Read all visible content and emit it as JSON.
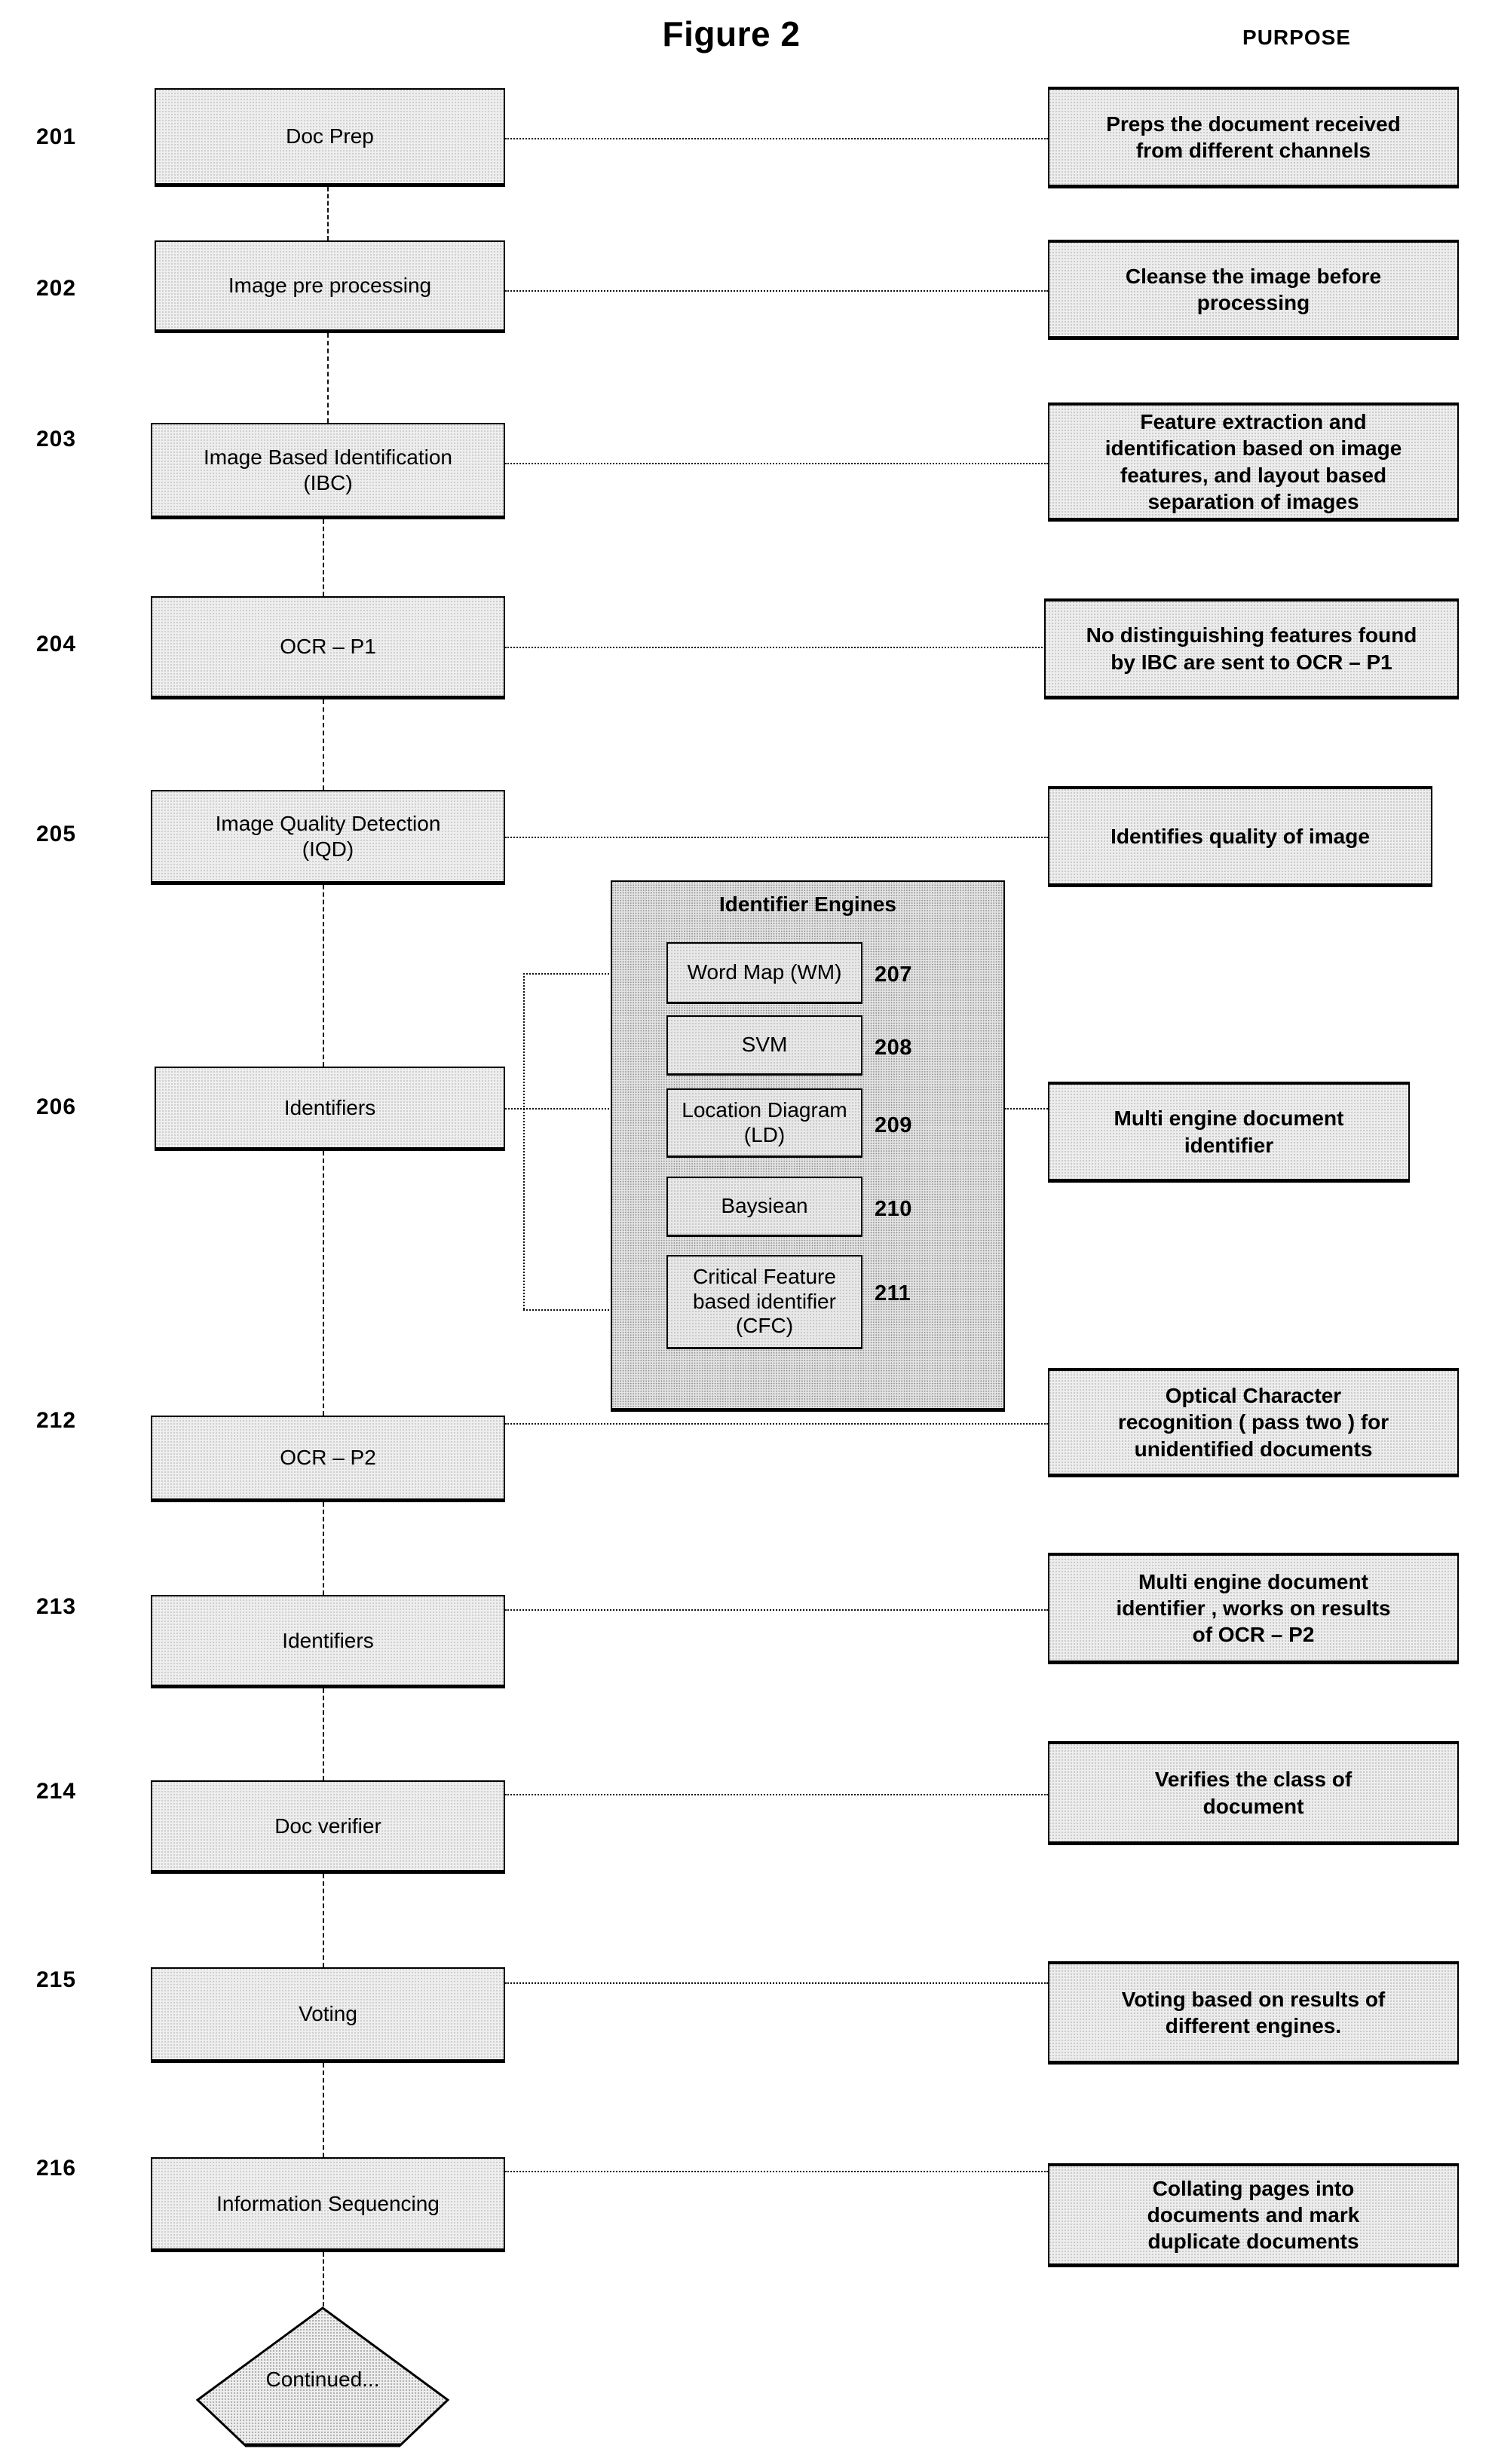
{
  "figure": {
    "title": "Figure 2",
    "purpose_header": "PURPOSE"
  },
  "steps": [
    {
      "num": "201",
      "label": "Doc Prep",
      "purpose": "Preps the document received\nfrom different channels"
    },
    {
      "num": "202",
      "label": "Image pre processing",
      "purpose": "Cleanse the image before\nprocessing"
    },
    {
      "num": "203",
      "label": "Image Based Identification\n(IBC)",
      "purpose": "Feature extraction and\nidentification based on image\nfeatures, and layout based\nseparation of images"
    },
    {
      "num": "204",
      "label": "OCR – P1",
      "purpose": "No distinguishing features found\nby IBC are sent to  OCR – P1"
    },
    {
      "num": "205",
      "label": "Image Quality Detection\n(IQD)",
      "purpose": "Identifies quality of image"
    },
    {
      "num": "206",
      "label": "Identifiers",
      "purpose": "Multi engine document\nidentifier"
    },
    {
      "num": "212",
      "label": "OCR – P2",
      "purpose": "Optical Character\nrecognition ( pass two ) for\nunidentified documents"
    },
    {
      "num": "213",
      "label": "Identifiers",
      "purpose": "Multi engine document\nidentifier , works on results\nof OCR – P2"
    },
    {
      "num": "214",
      "label": "Doc verifier",
      "purpose": "Verifies the class of\ndocument"
    },
    {
      "num": "215",
      "label": "Voting",
      "purpose": "Voting based on results of\ndifferent engines."
    },
    {
      "num": "216",
      "label": "Information Sequencing",
      "purpose": "Collating pages into\ndocuments and mark\nduplicate documents"
    }
  ],
  "engines_panel": {
    "title": "Identifier Engines",
    "engines": [
      {
        "num": "207",
        "label": "Word Map (WM)"
      },
      {
        "num": "208",
        "label": "SVM"
      },
      {
        "num": "209",
        "label": "Location Diagram\n(LD)"
      },
      {
        "num": "210",
        "label": "Baysiean"
      },
      {
        "num": "211",
        "label": "Critical Feature\nbased identifier\n(CFC)"
      }
    ]
  },
  "terminator": {
    "label": "Continued..."
  },
  "colors": {
    "ink": "#000000",
    "box_fill": "#eeeeee",
    "panel_fill": "#e4e4e4",
    "page_bg": "#ffffff"
  }
}
